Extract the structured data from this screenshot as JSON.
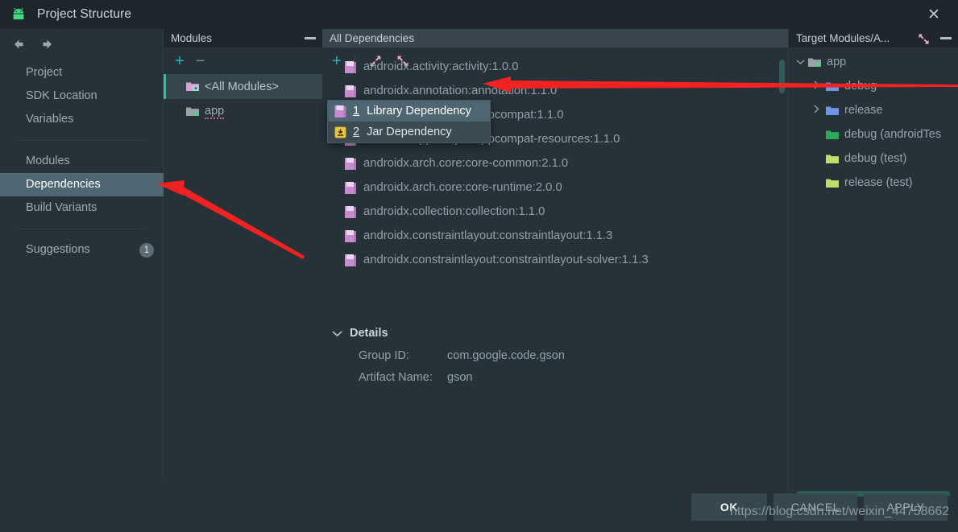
{
  "window": {
    "title": "Project Structure",
    "app_icon": "android-icon",
    "close_label": "✕"
  },
  "sidebar": {
    "back_icon": "arrow-left-icon",
    "forward_icon": "arrow-right-icon",
    "items": [
      {
        "label": "Project",
        "selected": false,
        "badge": ""
      },
      {
        "label": "SDK Location",
        "selected": false,
        "badge": ""
      },
      {
        "label": "Variables",
        "selected": false,
        "badge": ""
      },
      {
        "label": "Modules",
        "selected": false,
        "badge": ""
      },
      {
        "label": "Dependencies",
        "selected": true,
        "badge": ""
      },
      {
        "label": "Build Variants",
        "selected": false,
        "badge": ""
      },
      {
        "label": "Suggestions",
        "selected": false,
        "badge": "1"
      }
    ]
  },
  "modules_panel": {
    "title": "Modules",
    "minimize_icon": "minimize-icon",
    "add_label": "+",
    "remove_label": "−",
    "rows": [
      {
        "label": "<All Modules>",
        "selected": true,
        "icon": "modules-folder-icon"
      },
      {
        "label": "app",
        "selected": false,
        "icon": "module-folder-icon"
      }
    ]
  },
  "dependencies_panel": {
    "title": "All Dependencies",
    "add_label": "+",
    "expand_icon": "expand-all-icon",
    "collapse_icon": "collapse-all-icon",
    "rows": [
      "androidx.activity:activity:1.0.0",
      "androidx.annotation:annotation:1.1.0",
      "androidx.appcompat:appcompat:1.1.0",
      "androidx.appcompat:appcompat-resources:1.1.0",
      "androidx.arch.core:core-common:2.1.0",
      "androidx.arch.core:core-runtime:2.0.0",
      "androidx.collection:collection:1.1.0",
      "androidx.constraintlayout:constraintlayout:1.1.3",
      "androidx.constraintlayout:constraintlayout-solver:1.1.3"
    ]
  },
  "context_menu": {
    "items": [
      {
        "num": "1",
        "label": "Library Dependency",
        "icon": "library-icon",
        "highlighted": true
      },
      {
        "num": "2",
        "label": "Jar Dependency",
        "icon": "jar-icon",
        "highlighted": false
      }
    ]
  },
  "details": {
    "chevron": "⌄",
    "title": "Details",
    "fields": [
      {
        "label": "Group ID:",
        "value": "com.google.code.gson"
      },
      {
        "label": "Artifact Name:",
        "value": "gson"
      }
    ]
  },
  "target_panel": {
    "title": "Target Modules/A...",
    "collapse_icon": "collapse-all-icon",
    "minimize_icon": "minimize-icon",
    "rows": [
      {
        "label": "app",
        "indent": 0,
        "chevron": "⌄",
        "color": "#7d8a92"
      },
      {
        "label": "debug",
        "indent": 1,
        "chevron": "›",
        "color": "#6c96e8"
      },
      {
        "label": "release",
        "indent": 1,
        "chevron": "›",
        "color": "#6c96e8"
      },
      {
        "label": "debug (androidTes",
        "indent": 1,
        "chevron": "",
        "color": "#2bab5a"
      },
      {
        "label": "debug (test)",
        "indent": 1,
        "chevron": "",
        "color": "#c2dd6e"
      },
      {
        "label": "release (test)",
        "indent": 1,
        "chevron": "",
        "color": "#c2dd6e"
      }
    ]
  },
  "buttons": {
    "ok": "OK",
    "cancel": "CANCEL",
    "apply": "APPLY"
  },
  "watermark": "https://blog.csdn.net/weixin_44758662",
  "colors": {
    "background": "#263238",
    "titlebar": "#1f262b",
    "selection": "#4e6572",
    "accent_teal": "#1bbbbb",
    "scrollbar": "#2d5c5c",
    "arrow_red": "#f22222",
    "folder_pink": "#d9a0d8",
    "folder_blue": "#6c96e8",
    "folder_green": "#2bab5a",
    "folder_lime": "#c2dd6e"
  }
}
